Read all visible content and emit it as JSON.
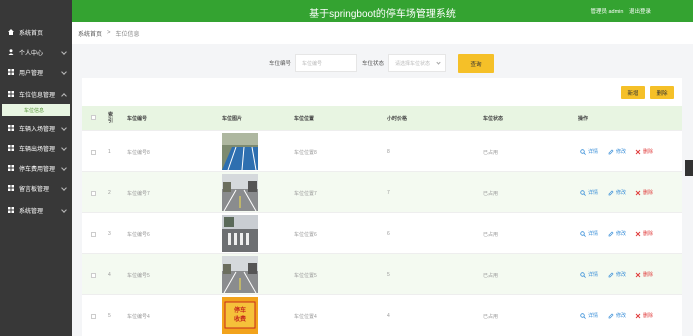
{
  "header": {
    "title": "基于springboot的停车场管理系统",
    "user": "管理员 admin",
    "logout": "退出登录"
  },
  "sidebar": {
    "items": [
      {
        "label": "系统首页",
        "icon": "home-icon"
      },
      {
        "label": "个人中心",
        "icon": "person-icon"
      },
      {
        "label": "用户管理",
        "icon": "grid-icon"
      },
      {
        "label": "车位信息管理",
        "icon": "grid-icon"
      },
      {
        "label": "车辆入场管理",
        "icon": "grid-icon"
      },
      {
        "label": "车辆出场管理",
        "icon": "grid-icon"
      },
      {
        "label": "停车费用管理",
        "icon": "grid-icon"
      },
      {
        "label": "留言板管理",
        "icon": "grid-icon"
      },
      {
        "label": "系统管理",
        "icon": "grid-icon"
      }
    ],
    "sub_item": "车位信息"
  },
  "breadcrumb": {
    "home": "系统首页",
    "sep": ">",
    "current": "车位信息"
  },
  "search": {
    "number_label": "车位编号",
    "number_placeholder": "车位编号",
    "status_label": "车位状态",
    "status_placeholder": "请选择车位状态",
    "query_button": "查询"
  },
  "actions": {
    "add": "新增",
    "delete": "删除"
  },
  "table": {
    "columns": [
      "索引",
      "车位编号",
      "车位图片",
      "车位位置",
      "小时价格",
      "车位状态",
      "操作"
    ],
    "rows": [
      {
        "index": "1",
        "number": "车位编号8",
        "location": "车位位置8",
        "price": "8",
        "status": "已占用",
        "img": "blue"
      },
      {
        "index": "2",
        "number": "车位编号7",
        "location": "车位位置7",
        "price": "7",
        "status": "已占用",
        "img": "street"
      },
      {
        "index": "3",
        "number": "车位编号6",
        "location": "车位位置6",
        "price": "6",
        "status": "已占用",
        "img": "crosswalk"
      },
      {
        "index": "4",
        "number": "车位编号5",
        "location": "车位位置5",
        "price": "5",
        "status": "已占用",
        "img": "street"
      },
      {
        "index": "5",
        "number": "车位编号4",
        "location": "车位位置4",
        "price": "4",
        "status": "已占用",
        "img": "sign",
        "sign_text": "停车收费"
      }
    ],
    "row_actions": {
      "detail": "详情",
      "edit": "修改",
      "delete": "删除"
    }
  },
  "colors": {
    "brand": "#34a331",
    "sidebar": "#383838",
    "accent": "#f5c028",
    "detail": "#3a8fd8",
    "edit": "#3a8fd8",
    "danger": "#e03a3a"
  }
}
